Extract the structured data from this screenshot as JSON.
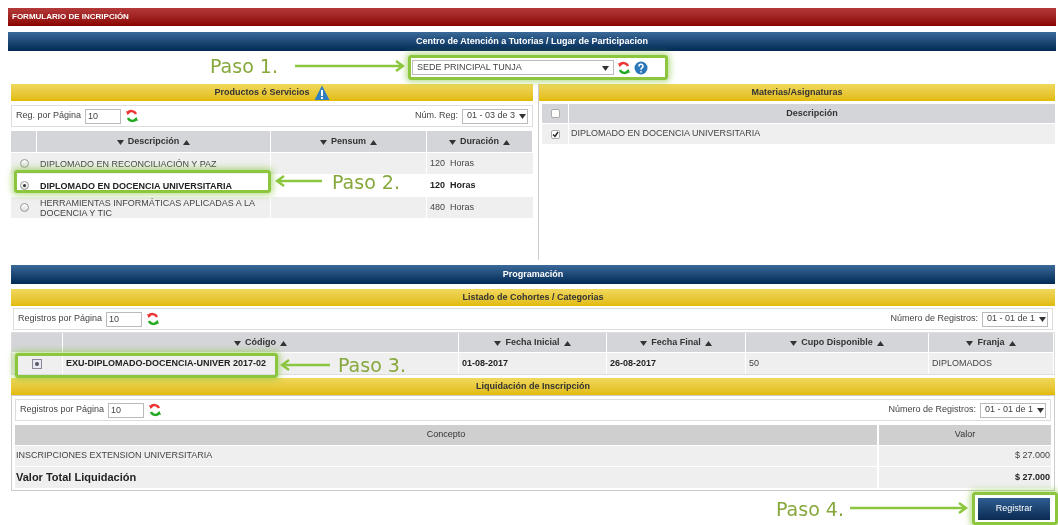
{
  "form_title": "FORMULARIO DE INCRIPCIÓN",
  "location_section": {
    "title": "Centro de Atención a Tutorias / Lugar de Participacion",
    "select_value": "SEDE PRINCIPAL TUNJA"
  },
  "products": {
    "title": "Productos ó Servicios",
    "per_page_label": "Reg. por Página",
    "per_page": "10",
    "count_label": "Núm. Reg:",
    "count_value": "01 - 03 de 3",
    "columns": [
      "Descripción",
      "Pensum",
      "Duración"
    ],
    "rows": [
      {
        "description": "DIPLOMADO EN RECONCILIACIÓN Y PAZ",
        "duration": "120  Horas",
        "selected": false
      },
      {
        "description": "DIPLOMADO EN DOCENCIA UNIVERSITARIA",
        "duration": "120  Horas",
        "selected": true
      },
      {
        "description": "HERRAMIENTAS INFORMÁTICAS APLICADAS A LA DOCENCIA Y TIC",
        "duration": "480  Horas",
        "selected": false
      }
    ]
  },
  "subjects": {
    "title": "Materias/Asignaturas",
    "all_checked": false,
    "column": "Descripción",
    "rows": [
      {
        "description": "DIPLOMADO EN DOCENCIA UNIVERSITARIA",
        "checked": true
      }
    ]
  },
  "programming": {
    "title": "Programación"
  },
  "cohorts": {
    "title": "Listado de Cohortes / Categorias",
    "per_page_label": "Registros por Página",
    "per_page": "10",
    "count_label": "Número de Registros:",
    "count_value": "01 - 01 de 1",
    "columns": [
      "Código",
      "Fecha Inicial",
      "Fecha Final",
      "Cupo Disponible",
      "Franja"
    ],
    "rows": [
      {
        "code": "EXU-DIPLOMADO-DOCENCIA-UNIVER 2017-02",
        "start": "01-08-2017",
        "end": "26-08-2017",
        "slots": "50",
        "band": "DIPLOMADOS",
        "selected": true
      }
    ]
  },
  "liquidation": {
    "title": "Liquidación de Inscripción",
    "per_page_label": "Registros por Página",
    "per_page": "10",
    "count_label": "Número de Registros:",
    "count_value": "01 - 01 de 1",
    "columns": [
      "Concepto",
      "Valor"
    ],
    "rows": [
      {
        "concept": "INSCRIPCIONES EXTENSION UNIVERSITARIA",
        "value": "$ 27.000"
      }
    ],
    "total_label": "Valor Total Liquidación",
    "total_value": "$ 27.000"
  },
  "submit_button": "Registrar",
  "steps": [
    {
      "label": "Paso 1."
    },
    {
      "label": "Paso 2."
    },
    {
      "label": "Paso 3."
    },
    {
      "label": "Paso 4."
    }
  ]
}
